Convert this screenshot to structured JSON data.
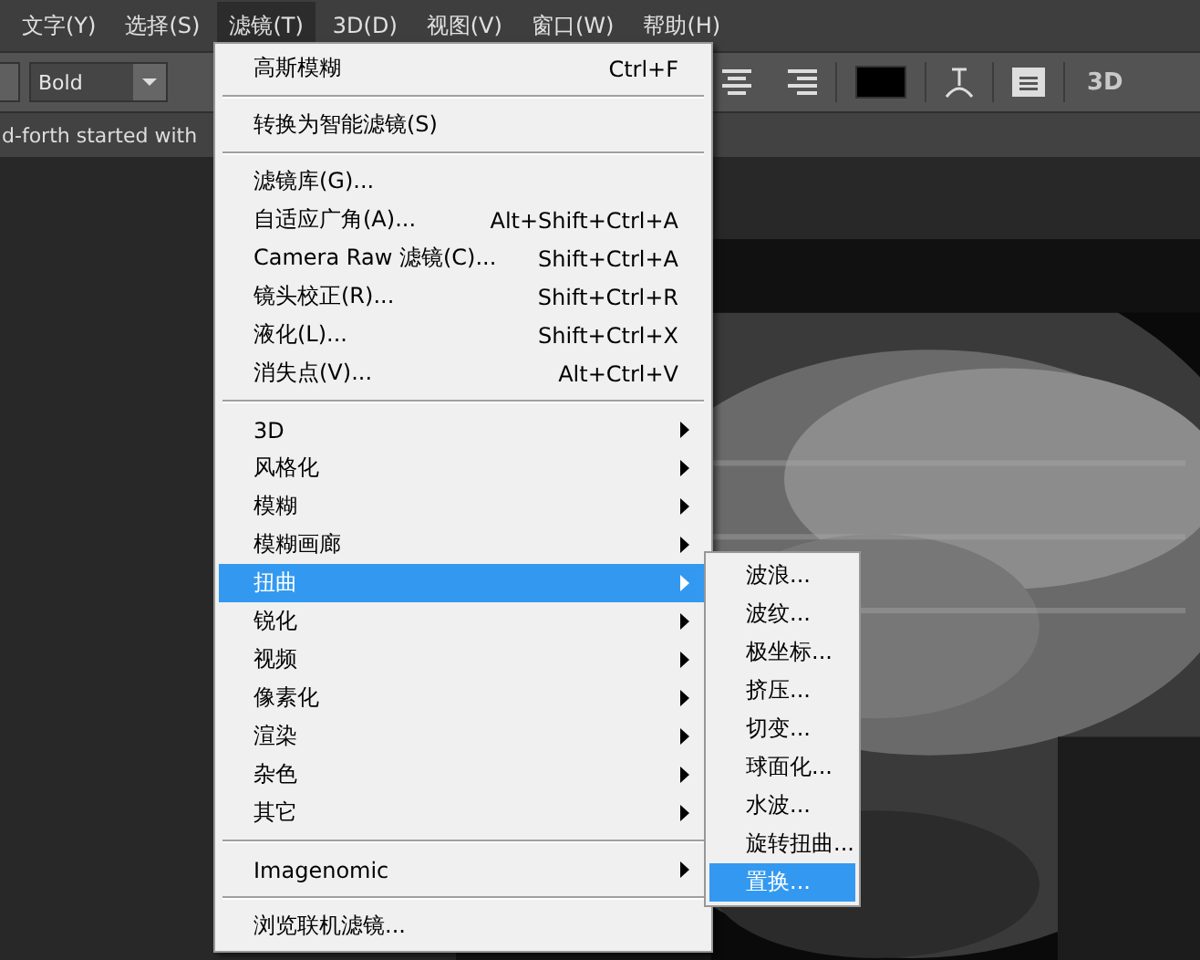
{
  "menubar": [
    {
      "label": "文字(Y)",
      "selected": false
    },
    {
      "label": "选择(S)",
      "selected": false
    },
    {
      "label": "滤镜(T)",
      "selected": true
    },
    {
      "label": "3D(D)",
      "selected": false
    },
    {
      "label": "视图(V)",
      "selected": false
    },
    {
      "label": "窗口(W)",
      "selected": false
    },
    {
      "label": "帮助(H)",
      "selected": false
    }
  ],
  "options_bar": {
    "font_style": "Bold",
    "mode_3d": "3D"
  },
  "document_tab": {
    "title": "d-forth started with"
  },
  "filter_menu": {
    "items": [
      {
        "kind": "item",
        "label": "高斯模糊",
        "shortcut": "Ctrl+F",
        "submenu": false,
        "selected": false
      },
      {
        "kind": "separator"
      },
      {
        "kind": "item",
        "label": "转换为智能滤镜(S)",
        "submenu": false,
        "selected": false
      },
      {
        "kind": "separator"
      },
      {
        "kind": "item",
        "label": "滤镜库(G)...",
        "submenu": false,
        "selected": false
      },
      {
        "kind": "item",
        "label": "自适应广角(A)...",
        "shortcut": "Alt+Shift+Ctrl+A",
        "submenu": false,
        "selected": false
      },
      {
        "kind": "item",
        "label": "Camera Raw 滤镜(C)...",
        "shortcut": "Shift+Ctrl+A",
        "submenu": false,
        "selected": false
      },
      {
        "kind": "item",
        "label": "镜头校正(R)...",
        "shortcut": "Shift+Ctrl+R",
        "submenu": false,
        "selected": false
      },
      {
        "kind": "item",
        "label": "液化(L)...",
        "shortcut": "Shift+Ctrl+X",
        "submenu": false,
        "selected": false
      },
      {
        "kind": "item",
        "label": "消失点(V)...",
        "shortcut": "Alt+Ctrl+V",
        "submenu": false,
        "selected": false
      },
      {
        "kind": "separator"
      },
      {
        "kind": "item",
        "label": "3D",
        "submenu": true,
        "selected": false
      },
      {
        "kind": "item",
        "label": "风格化",
        "submenu": true,
        "selected": false
      },
      {
        "kind": "item",
        "label": "模糊",
        "submenu": true,
        "selected": false
      },
      {
        "kind": "item",
        "label": "模糊画廊",
        "submenu": true,
        "selected": false
      },
      {
        "kind": "item",
        "label": "扭曲",
        "submenu": true,
        "selected": true
      },
      {
        "kind": "item",
        "label": "锐化",
        "submenu": true,
        "selected": false
      },
      {
        "kind": "item",
        "label": "视频",
        "submenu": true,
        "selected": false
      },
      {
        "kind": "item",
        "label": "像素化",
        "submenu": true,
        "selected": false
      },
      {
        "kind": "item",
        "label": "渲染",
        "submenu": true,
        "selected": false
      },
      {
        "kind": "item",
        "label": "杂色",
        "submenu": true,
        "selected": false
      },
      {
        "kind": "item",
        "label": "其它",
        "submenu": true,
        "selected": false
      },
      {
        "kind": "separator"
      },
      {
        "kind": "item",
        "label": "Imagenomic",
        "submenu": true,
        "selected": false
      },
      {
        "kind": "separator"
      },
      {
        "kind": "item",
        "label": "浏览联机滤镜...",
        "submenu": false,
        "selected": false
      }
    ]
  },
  "distort_submenu": {
    "items": [
      {
        "label": "波浪...",
        "selected": false
      },
      {
        "label": "波纹...",
        "selected": false
      },
      {
        "label": "极坐标...",
        "selected": false
      },
      {
        "label": "挤压...",
        "selected": false
      },
      {
        "label": "切变...",
        "selected": false
      },
      {
        "label": "球面化...",
        "selected": false
      },
      {
        "label": "水波...",
        "selected": false
      },
      {
        "label": "旋转扭曲...",
        "selected": false
      },
      {
        "label": "置换...",
        "selected": true
      }
    ]
  }
}
